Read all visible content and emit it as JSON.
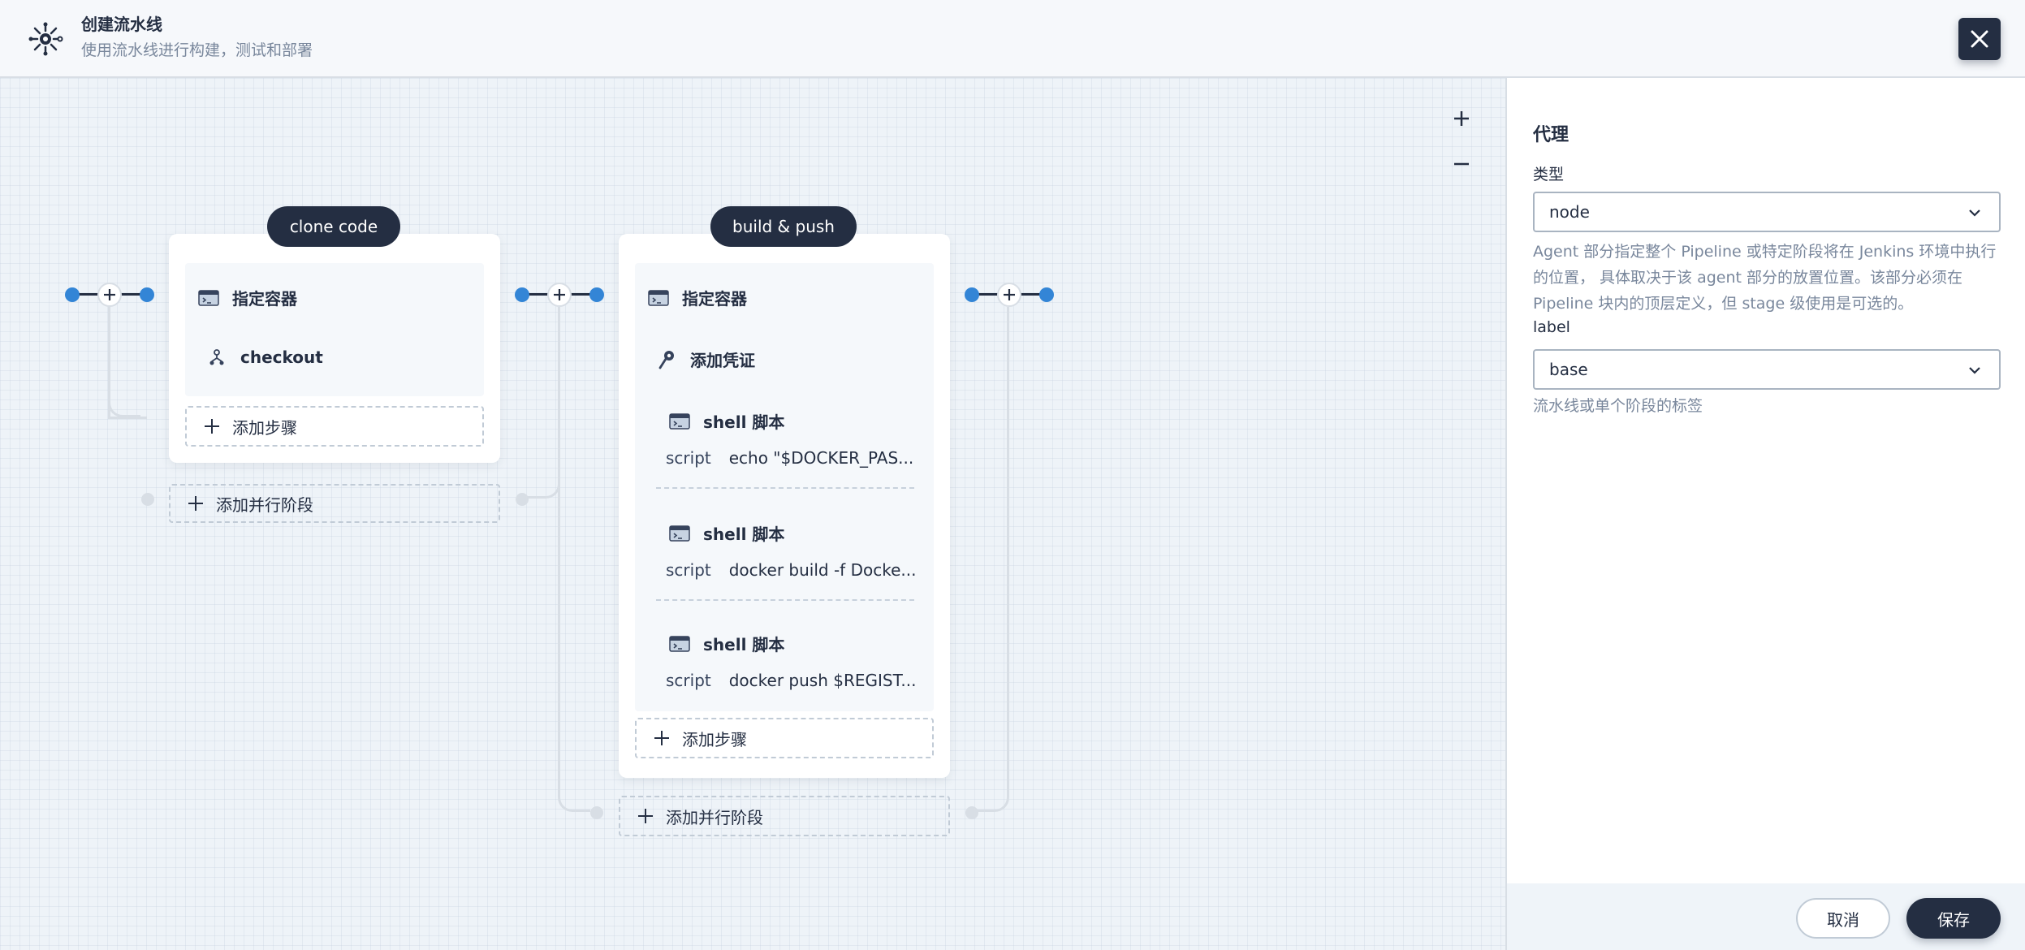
{
  "header": {
    "title": "创建流水线",
    "subtitle": "使用流水线进行构建，测试和部署",
    "logo_icon": "pipeline-icon",
    "close_icon": "close-icon"
  },
  "canvas": {
    "zoom_in_icon": "plus-icon",
    "zoom_out_icon": "minus-icon",
    "stages": [
      {
        "name": "clone code",
        "steps": [
          {
            "icon": "container-icon",
            "label": "指定容器"
          },
          {
            "icon": "git-branch-icon",
            "label": "checkout"
          }
        ],
        "add_step": "添加步骤",
        "add_parallel": "添加并行阶段"
      },
      {
        "name": "build & push",
        "steps": [
          {
            "icon": "container-icon",
            "label": "指定容器"
          },
          {
            "icon": "key-icon",
            "label": "添加凭证"
          },
          {
            "icon": "terminal-icon",
            "label": "shell 脚本",
            "script_key": "script",
            "script_value": "echo \"$DOCKER_PAS..."
          },
          {
            "icon": "terminal-icon",
            "label": "shell 脚本",
            "script_key": "script",
            "script_value": "docker build -f Docke..."
          },
          {
            "icon": "terminal-icon",
            "label": "shell 脚本",
            "script_key": "script",
            "script_value": "docker push $REGIST..."
          }
        ],
        "add_step": "添加步骤",
        "add_parallel": "添加并行阶段"
      }
    ]
  },
  "panel": {
    "title": "代理",
    "type_label": "类型",
    "type_value": "node",
    "type_description": "Agent 部分指定整个 Pipeline 或特定阶段将在 Jenkins 环境中执行的位置， 具体取决于该 agent 部分的放置位置。该部分必须在 Pipeline 块内的顶层定义，但 stage 级使用是可选的。",
    "label_label": "label",
    "label_value": "base",
    "label_description": "流水线或单个阶段的标签",
    "cancel": "取消",
    "save": "保存"
  },
  "colors": {
    "dark": "#242e42",
    "accent_blue": "#3385d6",
    "muted_text": "#79879c",
    "border": "#d8dee5"
  }
}
